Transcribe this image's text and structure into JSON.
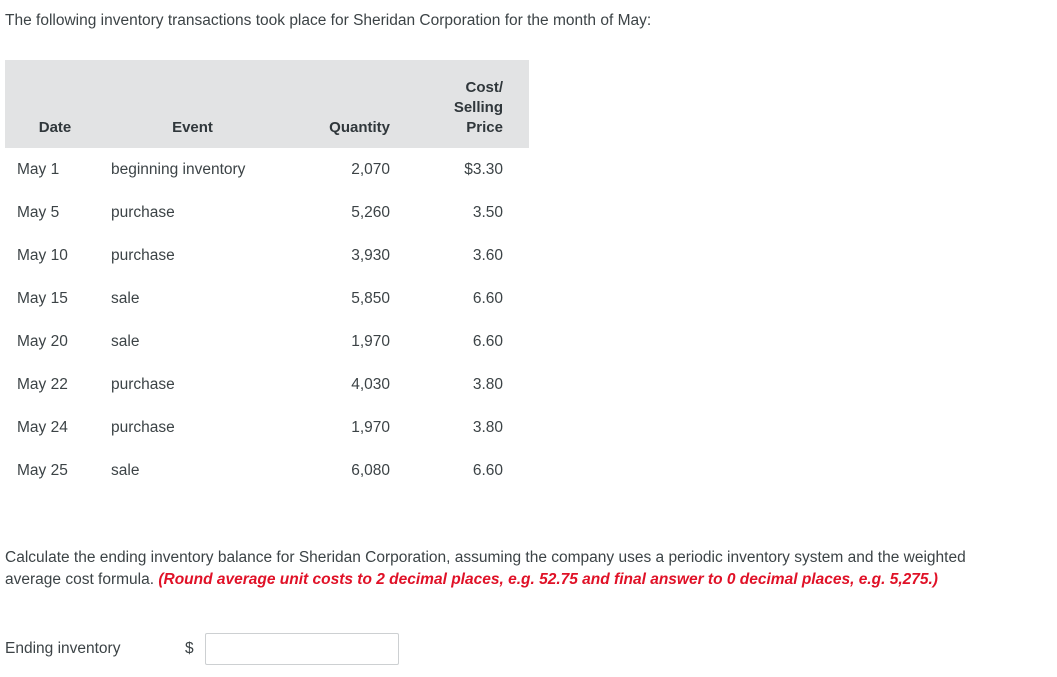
{
  "intro": "The following inventory transactions took place for Sheridan Corporation for the month of May:",
  "table": {
    "headers": {
      "date": "Date",
      "event": "Event",
      "quantity": "Quantity",
      "price_line1": "Cost/",
      "price_line2": "Selling",
      "price_line3": "Price"
    },
    "rows": [
      {
        "date": "May 1",
        "event": "beginning inventory",
        "quantity": "2,070",
        "price": "$3.30"
      },
      {
        "date": "May 5",
        "event": "purchase",
        "quantity": "5,260",
        "price": "3.50"
      },
      {
        "date": "May 10",
        "event": "purchase",
        "quantity": "3,930",
        "price": "3.60"
      },
      {
        "date": "May 15",
        "event": "sale",
        "quantity": "5,850",
        "price": "6.60"
      },
      {
        "date": "May 20",
        "event": "sale",
        "quantity": "1,970",
        "price": "6.60"
      },
      {
        "date": "May 22",
        "event": "purchase",
        "quantity": "4,030",
        "price": "3.80"
      },
      {
        "date": "May 24",
        "event": "purchase",
        "quantity": "1,970",
        "price": "3.80"
      },
      {
        "date": "May 25",
        "event": "sale",
        "quantity": "6,080",
        "price": "6.60"
      }
    ]
  },
  "question": {
    "main": "Calculate the ending inventory balance for Sheridan Corporation, assuming the company uses a periodic inventory system and the weighted average cost formula. ",
    "emphasis": "(Round average unit costs to 2 decimal places, e.g. 52.75 and final answer to 0 decimal places, e.g. 5,275.)"
  },
  "answer": {
    "label": "Ending inventory",
    "currency_symbol": "$",
    "value": "",
    "placeholder": ""
  },
  "colors": {
    "header_background": "#e2e3e4",
    "text": "#3c4346",
    "emphasis_red": "#e01127",
    "input_border": "#cdd0d2"
  }
}
